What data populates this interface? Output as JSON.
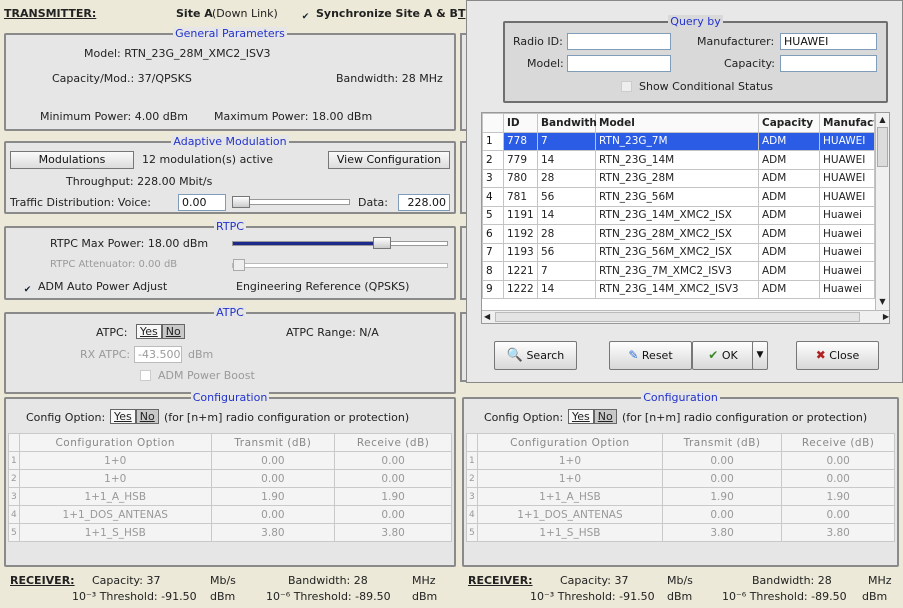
{
  "transmitter": {
    "label": "TRANSMITTER:",
    "site": "Site A",
    "site_suffix": "(Down Link)",
    "sync_label": "Synchronize Site A & B",
    "next_tab_initial": "T"
  },
  "general": {
    "title": "General Parameters",
    "model": "Model: RTN_23G_28M_XMC2_ISV3",
    "capacity": "Capacity/Mod.: 37/QPSKS",
    "bandwidth": "Bandwidth: 28 MHz",
    "min_power": "Minimum Power: 4.00 dBm",
    "max_power": "Maximum Power: 18.00 dBm"
  },
  "adaptive": {
    "title": "Adaptive Modulation",
    "modulations_button": "Modulations",
    "active": "12 modulation(s) active",
    "view_config_button": "View Configuration",
    "throughput": "Throughput: 228.00 Mbit/s",
    "traffic_label": "Traffic Distribution: Voice:",
    "voice_value": "0.00",
    "data_label": "Data:",
    "data_value": "228.00",
    "voice_fraction": 0.0
  },
  "rtpc": {
    "title": "RTPC",
    "max_power": "RTPC Max Power: 18.00 dBm",
    "attenuator": "RTPC Attenuator: 0.00 dB",
    "auto_adjust": "ADM Auto Power Adjust",
    "engineering": "Engineering Reference (QPSKS)",
    "max_power_fraction": 0.75,
    "attenuator_fraction": 0.0
  },
  "atpc": {
    "title": "ATPC",
    "label": "ATPC:",
    "yes": "Yes",
    "no": "No",
    "range": "ATPC Range: N/A",
    "rx_label": "RX ATPC:",
    "rx_value": "-43.500",
    "rx_unit": "dBm",
    "boost": "ADM Power Boost"
  },
  "config_left": {
    "title": "Configuration",
    "option_label": "Config Option:",
    "yes": "Yes",
    "no": "No",
    "note": "(for [n+m] radio configuration or protection)",
    "headers": [
      "Configuration Option",
      "Transmit (dB)",
      "Receive (dB)"
    ],
    "rows": [
      [
        "1",
        "1+0",
        "0.00",
        "0.00"
      ],
      [
        "2",
        "1+0",
        "0.00",
        "0.00"
      ],
      [
        "3",
        "1+1_A_HSB",
        "1.90",
        "1.90"
      ],
      [
        "4",
        "1+1_DOS_ANTENAS",
        "0.00",
        "0.00"
      ],
      [
        "5",
        "1+1_S_HSB",
        "3.80",
        "3.80"
      ]
    ]
  },
  "config_right": {
    "title": "Configuration",
    "option_label": "Config Option:",
    "yes": "Yes",
    "no": "No",
    "note": "(for [n+m] radio configuration or protection)",
    "headers": [
      "Configuration Option",
      "Transmit (dB)",
      "Receive (dB)"
    ],
    "rows": [
      [
        "1",
        "1+0",
        "0.00",
        "0.00"
      ],
      [
        "2",
        "1+0",
        "0.00",
        "0.00"
      ],
      [
        "3",
        "1+1_A_HSB",
        "1.90",
        "1.90"
      ],
      [
        "4",
        "1+1_DOS_ANTENAS",
        "0.00",
        "0.00"
      ],
      [
        "5",
        "1+1_S_HSB",
        "3.80",
        "3.80"
      ]
    ]
  },
  "receiver_left": {
    "label": "RECEIVER:",
    "capacity": "Capacity: 37",
    "cap_unit": "Mb/s",
    "bandwidth": "Bandwidth: 28",
    "bw_unit": "MHz",
    "thr3": "10⁻³ Threshold: -91.50",
    "thr3_unit": "dBm",
    "thr6": "10⁻⁶ Threshold: -89.50",
    "thr6_unit": "dBm"
  },
  "receiver_right": {
    "label": "RECEIVER:",
    "capacity": "Capacity: 37",
    "cap_unit": "Mb/s",
    "bandwidth": "Bandwidth: 28",
    "bw_unit": "MHz",
    "thr3": "10⁻³ Threshold: -91.50",
    "thr3_unit": "dBm",
    "thr6": "10⁻⁶ Threshold: -89.50",
    "thr6_unit": "dBm"
  },
  "query": {
    "title": "Query by",
    "radio_id_label": "Radio ID:",
    "radio_id_value": "",
    "manufacturer_label": "Manufacturer:",
    "manufacturer_value": "HUAWEI",
    "model_label": "Model:",
    "model_value": "",
    "capacity_label": "Capacity:",
    "capacity_value": "",
    "show_conditional": "Show Conditional Status"
  },
  "results": {
    "headers": [
      "",
      "ID",
      "Bandwith",
      "Model",
      "Capacity",
      "Manufactur"
    ],
    "rows": [
      [
        "1",
        "778",
        "7",
        "RTN_23G_7M",
        "ADM",
        "HUAWEI"
      ],
      [
        "2",
        "779",
        "14",
        "RTN_23G_14M",
        "ADM",
        "HUAWEI"
      ],
      [
        "3",
        "780",
        "28",
        "RTN_23G_28M",
        "ADM",
        "HUAWEI"
      ],
      [
        "4",
        "781",
        "56",
        "RTN_23G_56M",
        "ADM",
        "HUAWEI"
      ],
      [
        "5",
        "1191",
        "14",
        "RTN_23G_14M_XMC2_ISX",
        "ADM",
        "Huawei"
      ],
      [
        "6",
        "1192",
        "28",
        "RTN_23G_28M_XMC2_ISX",
        "ADM",
        "Huawei"
      ],
      [
        "7",
        "1193",
        "56",
        "RTN_23G_56M_XMC2_ISX",
        "ADM",
        "Huawei"
      ],
      [
        "8",
        "1221",
        "7",
        "RTN_23G_7M_XMC2_ISV3",
        "ADM",
        "Huawei"
      ],
      [
        "9",
        "1222",
        "14",
        "RTN_23G_14M_XMC2_ISV3",
        "ADM",
        "Huawei"
      ]
    ],
    "selected_row": 0
  },
  "buttons": {
    "search": "Search",
    "reset": "Reset",
    "ok": "OK",
    "close": "Close"
  },
  "colors": {
    "selection": "#2a5ce5",
    "group_title": "#2233cc"
  }
}
